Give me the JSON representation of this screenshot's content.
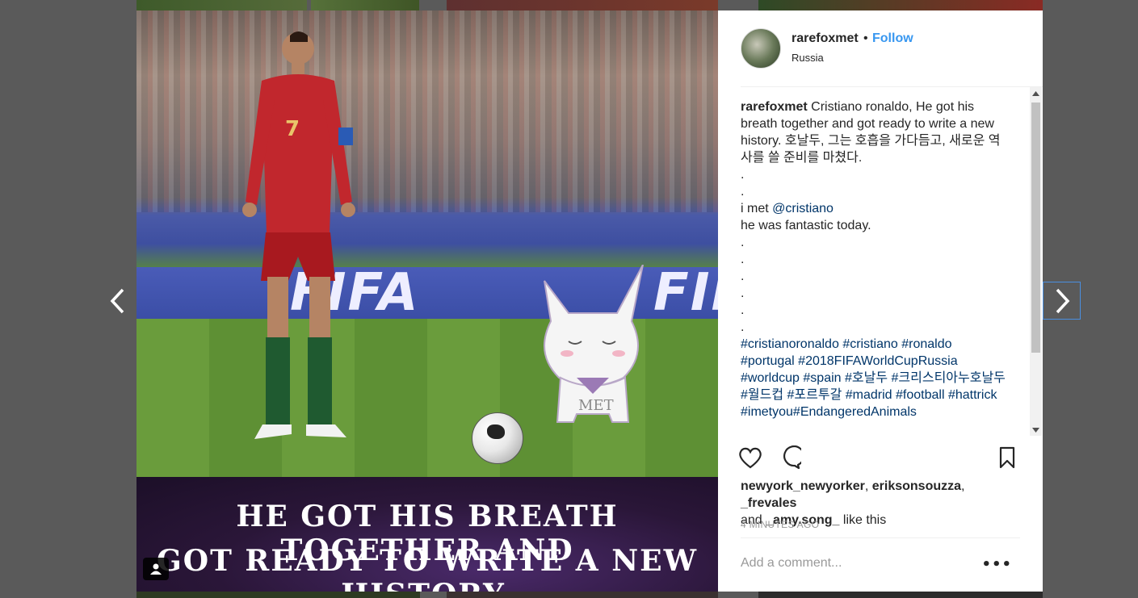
{
  "post": {
    "username": "rarefoxmet",
    "separator": "•",
    "follow_label": "Follow",
    "location": "Russia",
    "image": {
      "board_text_left": "FIFA",
      "board_text_right": "FIFA",
      "jersey_number": "7",
      "cat_label": "MET",
      "banner_line1": "He got his breath together and",
      "banner_line2": "got ready to write a new history."
    },
    "caption": {
      "username": "rarefoxmet",
      "text_en": "Cristiano ronaldo, He got his breath together and got ready to write a new history.",
      "text_ko": "호날두, 그는 호흡을 가다듬고, 새로운 역사를 쓸 준비를 마쳤다.",
      "dot1": ".",
      "dot2": ".",
      "met_prefix": "i met ",
      "mention": "@cristiano",
      "fantastic": "he was fantastic today.",
      "dots_after": [
        ".",
        ".",
        ".",
        ".",
        ".",
        "."
      ],
      "hashtags": [
        "#cristianoronaldo",
        "#cristiano",
        "#ronaldo",
        "#portugal",
        "#2018FIFAWorldCupRussia",
        "#worldcup",
        "#spain",
        "#호날두",
        "#크리스티아누호날두",
        "#월드컵",
        "#포르투갈",
        "#madrid",
        "#football",
        "#hattrick",
        "#imetyou",
        "#EndangeredAnimals"
      ]
    },
    "likes": {
      "user1": "newyork_newyorker",
      "sep1": ", ",
      "user2": "eriksonsouzza",
      "sep2": ", ",
      "user3": "_frevales",
      "and_text": "and ",
      "user4": "_amy.song_",
      "like_text": " like this"
    },
    "time_ago": "4 MINUTES AGO",
    "comment_placeholder": "Add a comment...",
    "more_label": "•••"
  },
  "icons": {
    "prev": "chevron-left-icon",
    "next": "chevron-right-icon",
    "like": "heart-icon",
    "comment": "comment-bubble-icon",
    "save": "bookmark-icon",
    "tagged": "user-tag-icon"
  },
  "colors": {
    "link": "#3897f0",
    "hashtag": "#003569",
    "text": "#262626",
    "muted": "#999999"
  }
}
